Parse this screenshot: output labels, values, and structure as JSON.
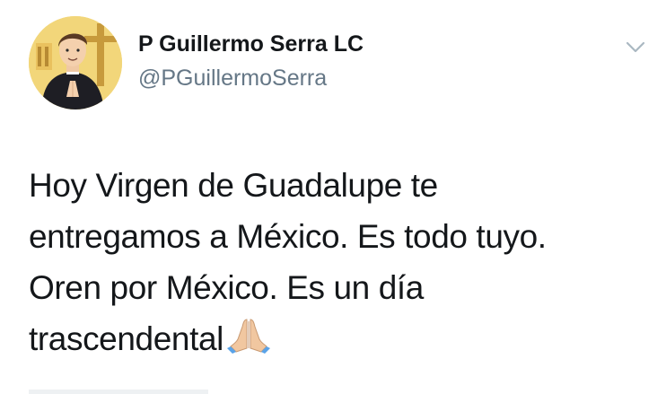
{
  "author": {
    "display_name": "P Guillermo Serra LC",
    "handle": "@PGuillermoSerra",
    "avatar_icon": "priest-cartoon-avatar"
  },
  "menu": {
    "icon": "chevron-down-icon"
  },
  "tweet": {
    "lines": [
      "Hoy Virgen de Guadalupe te",
      "entregamos a México. Es todo tuyo.",
      "Oren por México. Es un día",
      "trascendental"
    ],
    "emoji": "folded-hands-emoji"
  },
  "colors": {
    "text": "#14171a",
    "secondary": "#657786",
    "caret": "#aab8c2"
  }
}
